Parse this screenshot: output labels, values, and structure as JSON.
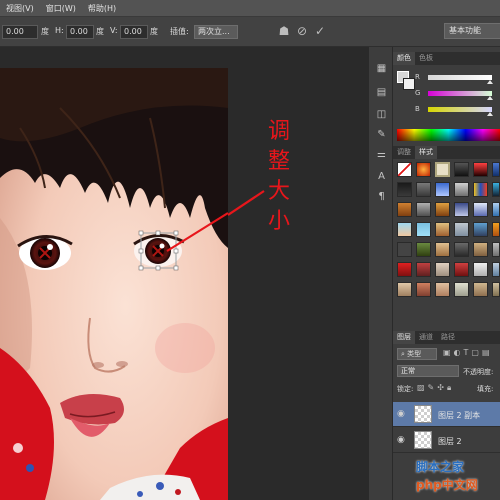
{
  "menubar": {
    "items": [
      "视图(V)",
      "窗口(W)",
      "帮助(H)"
    ]
  },
  "options": {
    "x_value": "0.00",
    "x_unit": "度",
    "h_label": "H:",
    "h_value": "0.00",
    "h_unit": "度",
    "v_label": "V:",
    "v_value": "0.00",
    "v_unit": "度",
    "interp_label": "插值:",
    "interp_value": "两次立...",
    "workspace": "基本功能"
  },
  "annotation": {
    "text": [
      "调",
      "整",
      "大",
      "小"
    ],
    "color": "#e8161b"
  },
  "color_panel": {
    "tabs": [
      "颜色",
      "色板"
    ],
    "sliders": [
      "R",
      "G",
      "B"
    ]
  },
  "styles_panel": {
    "tabs": [
      "调整",
      "样式"
    ]
  },
  "layers_panel": {
    "tabs": [
      "图层",
      "通道",
      "路径"
    ],
    "kind_label": "类型",
    "blend_mode": "正常",
    "opacity_label": "不透明度:",
    "lock_label": "锁定:",
    "fill_label": "填充:",
    "layers": [
      {
        "name": "图层 2 副本",
        "selected": true
      },
      {
        "name": "图层 2",
        "selected": false
      }
    ]
  },
  "watermark": {
    "line1": "脚本之家",
    "line2": "php中文网"
  }
}
